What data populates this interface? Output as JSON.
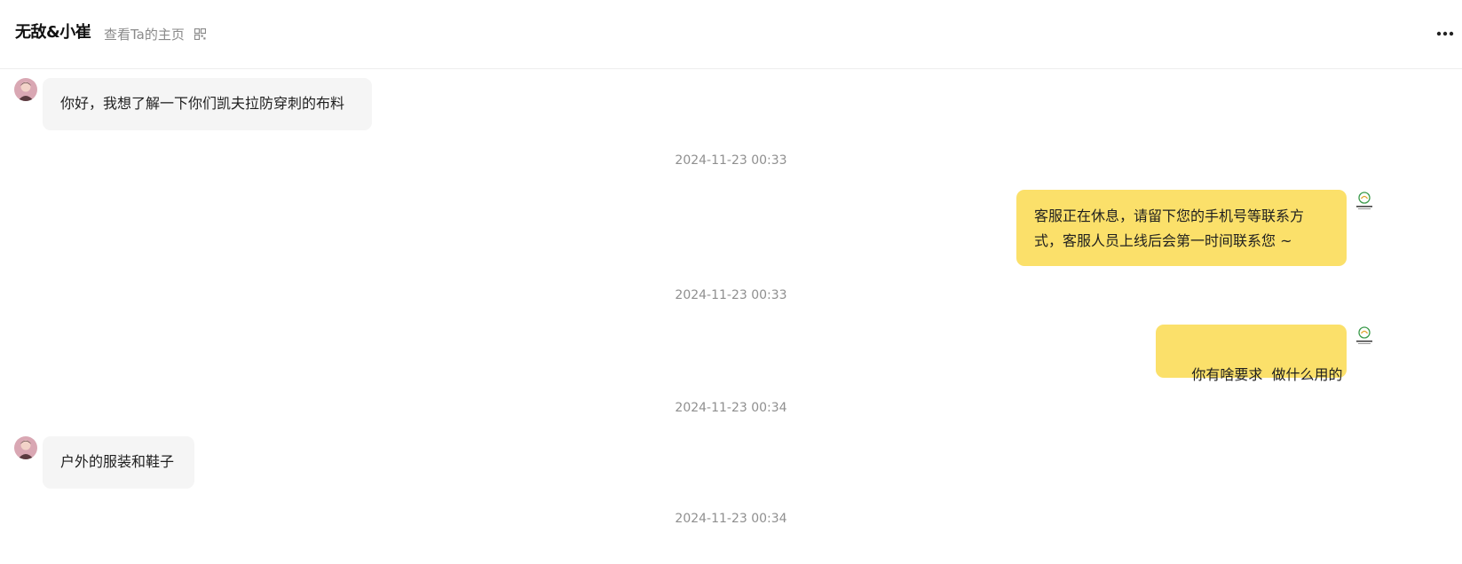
{
  "header": {
    "title": "无敌&小崔",
    "home_link": "查看Ta的主页",
    "qr_icon": "qr-code-icon",
    "more_icon": "more-horizontal-icon"
  },
  "messages": [
    {
      "kind": "in",
      "text": "你好，我想了解一下你们凯夫拉防穿刺的布料"
    },
    {
      "kind": "time",
      "text": "2024-11-23 00:33"
    },
    {
      "kind": "out",
      "text": "客服正在休息，请留下您的手机号等联系方式，客服人员上线后会第一时间联系您 ~"
    },
    {
      "kind": "time",
      "text": "2024-11-23 00:33"
    },
    {
      "kind": "out",
      "text": "你有啥要求  做什么用的"
    },
    {
      "kind": "time",
      "text": "2024-11-23 00:34"
    },
    {
      "kind": "in",
      "text": "户外的服装和鞋子"
    },
    {
      "kind": "time",
      "text": "2024-11-23 00:34"
    }
  ],
  "colors": {
    "incoming_bubble": "#f5f5f5",
    "outgoing_bubble": "#fbe06a",
    "timestamp": "#8f8f8f"
  }
}
